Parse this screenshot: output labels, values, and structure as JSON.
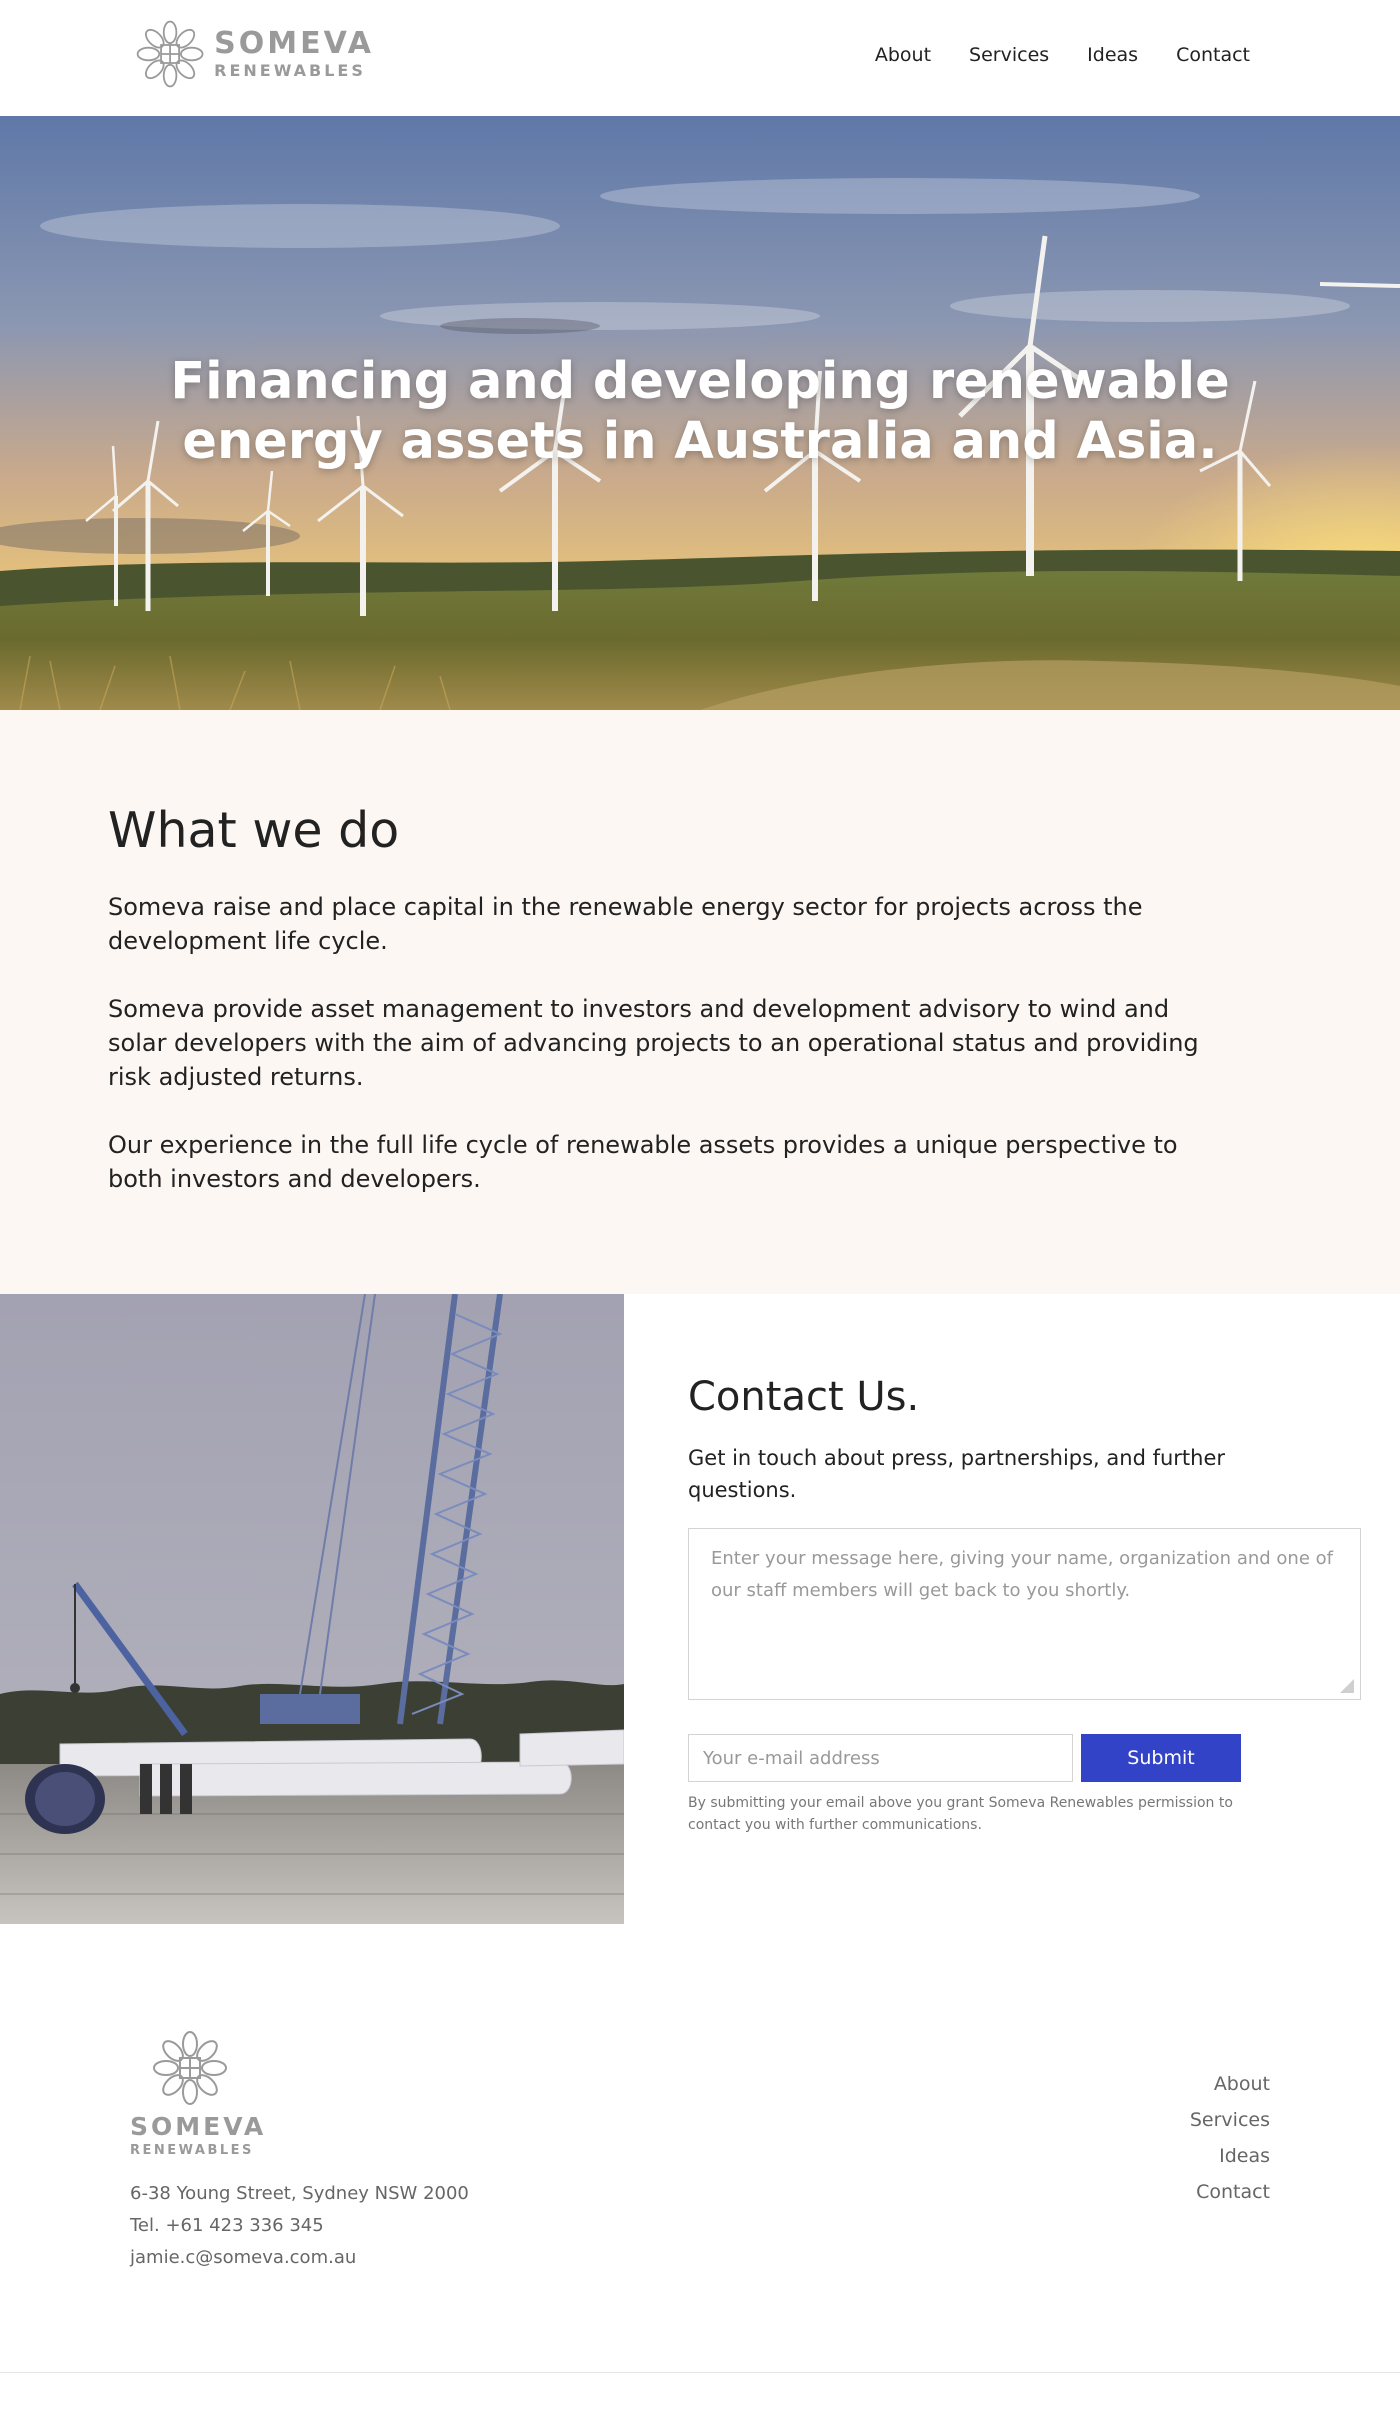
{
  "header": {
    "logo_name": "SOMEVA",
    "logo_sub": "RENEWABLES",
    "nav": [
      {
        "label": "About"
      },
      {
        "label": "Services"
      },
      {
        "label": "Ideas"
      },
      {
        "label": "Contact"
      }
    ]
  },
  "hero": {
    "title_line1": "Financing and developing renewable",
    "title_line2": "energy assets in Australia and Asia."
  },
  "what": {
    "heading": "What we do",
    "paragraphs": [
      "Someva raise and place capital in the renewable energy sector for projects across the development life cycle.",
      "Someva provide asset management to investors and development advisory to wind and solar developers with the aim of advancing projects to an operational status and providing risk adjusted returns.",
      "Our experience in the full life cycle of renewable assets provides a unique perspective to both investors and developers."
    ]
  },
  "contact": {
    "heading": "Contact Us.",
    "intro": "Get in touch about press, partnerships, and further questions.",
    "message_placeholder": "Enter your message here, giving your name, organization and one of our staff members will get back to you shortly.",
    "email_placeholder": "Your e-mail address",
    "submit_label": "Submit",
    "disclaimer": "By submitting your email above you grant Someva Renewables permission to contact you with further communications."
  },
  "footer": {
    "logo_name": "SOMEVA",
    "logo_sub": "RENEWABLES",
    "address": "6-38 Young Street, Sydney NSW 2000",
    "phone": "Tel. +61 423 336 345",
    "email": "jamie.c@someva.com.au",
    "nav": [
      {
        "label": "About"
      },
      {
        "label": "Services"
      },
      {
        "label": "Ideas"
      },
      {
        "label": "Contact"
      }
    ]
  },
  "colors": {
    "accent": "#3343c8",
    "section_bg": "#fcf7f3",
    "logo_gray": "#9a9a9a"
  }
}
